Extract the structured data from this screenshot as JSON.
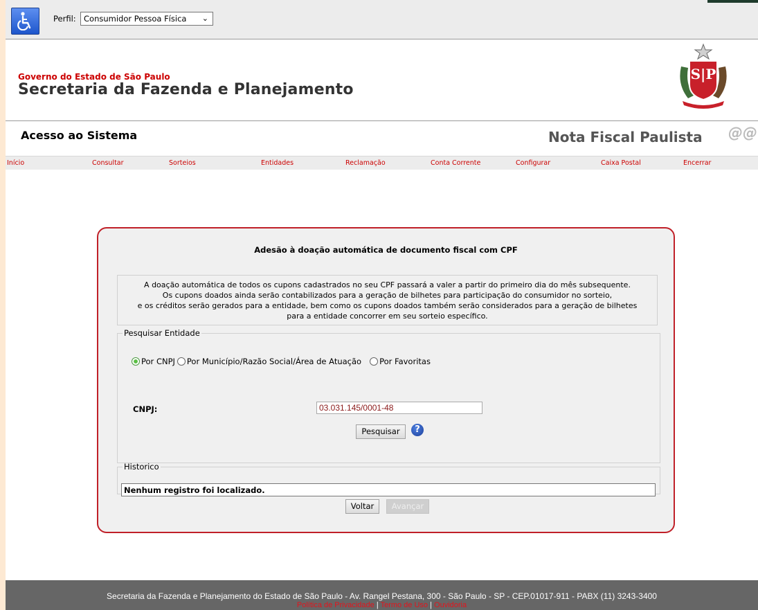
{
  "topbar": {
    "perfil_label": "Perfil:",
    "perfil_selected": "Consumidor Pessoa Física"
  },
  "header": {
    "governo": "Governo do Estado de São Paulo",
    "secretaria": "Secretaria da Fazenda e Planejamento"
  },
  "section": {
    "title": "Acesso ao Sistema",
    "brand": "Nota Fiscal Paulista"
  },
  "nav": [
    "Início",
    "Consultar",
    "Sorteios",
    "Entidades",
    "Reclamação",
    "Conta Corrente",
    "Configurar",
    "Caixa Postal",
    "Encerrar"
  ],
  "panel": {
    "title": "Adesão à doação automática de documento fiscal com CPF",
    "info": [
      "A doação automática de todos os cupons cadastrados no seu CPF passará a valer a partir do primeiro dia do mês subsequente.",
      "Os cupons doados ainda serão contabilizados para a geração de bilhetes para participação do consumidor no sorteio,",
      "e os créditos serão gerados para a entidade, bem como os cupons doados também serão considerados para a geração de bilhetes",
      "para a entidade concorrer em seu sorteio específico."
    ],
    "search_legend": "Pesquisar Entidade",
    "radios": [
      "Por CNPJ",
      "Por Município/Razão Social/Área de Atuação",
      "Por Favoritas"
    ],
    "radio_selected": 0,
    "cnpj_label": "CNPJ:",
    "cnpj_value": "03.031.145/0001-48",
    "search_button": "Pesquisar",
    "history_legend": "Historico",
    "history_text": "Nenhum registro foi localizado.",
    "back_button": "Voltar",
    "next_button": "Avançar"
  },
  "footer": {
    "address": "Secretaria da Fazenda e Planejamento do Estado de São Paulo - Av. Rangel Pestana, 300 - São Paulo - SP - CEP.01017-911 - PABX (11) 3243-3400",
    "links": [
      "Política de Privacidade",
      "Termo de Uso",
      "Ouvidoria"
    ],
    "separator": "|"
  },
  "colors": {
    "accent_red": "#c02028",
    "nav_text": "#cc0000",
    "footer_bg": "#666666"
  }
}
